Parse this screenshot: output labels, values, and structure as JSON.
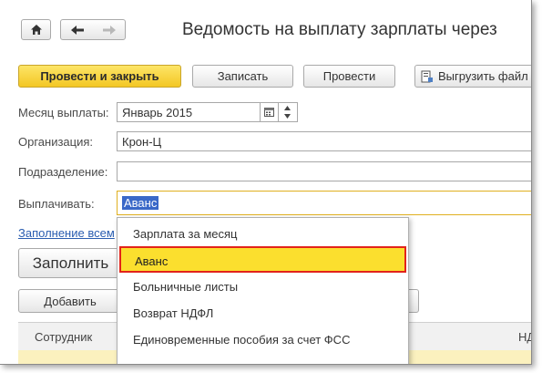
{
  "header": {
    "title": "Ведомость на выплату зарплаты через"
  },
  "toolbar": {
    "post_and_close": "Провести и закрыть",
    "save": "Записать",
    "post": "Провести",
    "export_file": "Выгрузить файл"
  },
  "form": {
    "month_label": "Месяц выплаты:",
    "month_value": "Январь 2015",
    "organization_label": "Организация:",
    "organization_value": "Крон-Ц",
    "department_label": "Подразделение:",
    "department_value": "",
    "payout_label": "Выплачивать:",
    "payout_value": "Аванс"
  },
  "fill_link": "Заполнение всем",
  "fill_button": "Заполнить",
  "add_button": "Добавить",
  "table": {
    "col_employee": "Сотрудник",
    "col_ndfl": "НД"
  },
  "dropdown": {
    "items": [
      {
        "label": "Зарплата за месяц"
      },
      {
        "label": "Аванс"
      },
      {
        "label": "Больничные листы"
      },
      {
        "label": "Возврат НДФЛ"
      },
      {
        "label": "Единовременные пособия за счет ФСС"
      }
    ],
    "selected_index": 1
  },
  "colors": {
    "primary_button": "#f3c724",
    "highlight": "#fbdf2e",
    "highlight_border": "#e2231a",
    "selection": "#3a68c8",
    "link": "#2a5db0"
  }
}
